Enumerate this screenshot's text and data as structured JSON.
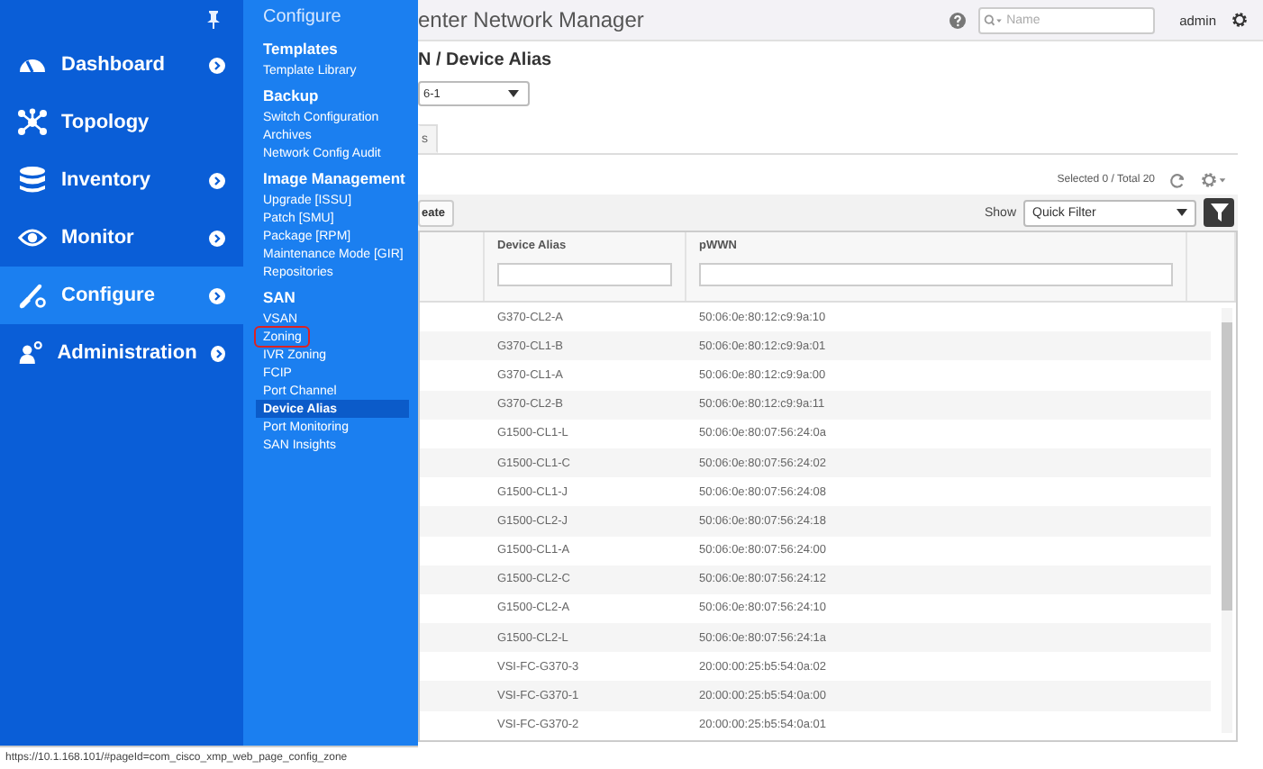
{
  "nav": {
    "items": [
      {
        "label": "Dashboard",
        "kind": "gauge",
        "has_arrow": true,
        "selected": false
      },
      {
        "label": "Topology",
        "kind": "nodes",
        "has_arrow": false,
        "selected": false
      },
      {
        "label": "Inventory",
        "kind": "database",
        "has_arrow": true,
        "selected": false
      },
      {
        "label": "Monitor",
        "kind": "eye",
        "has_arrow": true,
        "selected": false
      },
      {
        "label": "Configure",
        "kind": "wrench",
        "has_arrow": true,
        "selected": true
      },
      {
        "label": "Administration",
        "kind": "person",
        "has_arrow": true,
        "selected": false
      }
    ]
  },
  "flyout": {
    "title": "Configure",
    "sections": [
      {
        "heading": "Templates",
        "items": [
          {
            "label": "Template Library",
            "selected": false,
            "outlined": false
          }
        ]
      },
      {
        "heading": "Backup",
        "items": [
          {
            "label": "Switch Configuration",
            "selected": false,
            "outlined": false
          },
          {
            "label": "Archives",
            "selected": false,
            "outlined": false
          },
          {
            "label": "Network Config Audit",
            "selected": false,
            "outlined": false
          }
        ]
      },
      {
        "heading": "Image Management",
        "items": [
          {
            "label": "Upgrade [ISSU]",
            "selected": false,
            "outlined": false
          },
          {
            "label": "Patch [SMU]",
            "selected": false,
            "outlined": false
          },
          {
            "label": "Package [RPM]",
            "selected": false,
            "outlined": false
          },
          {
            "label": "Maintenance Mode [GIR]",
            "selected": false,
            "outlined": false
          },
          {
            "label": "Repositories",
            "selected": false,
            "outlined": false
          }
        ]
      },
      {
        "heading": "SAN",
        "items": [
          {
            "label": "VSAN",
            "selected": false,
            "outlined": false
          },
          {
            "label": "Zoning",
            "selected": false,
            "outlined": true
          },
          {
            "label": "IVR Zoning",
            "selected": false,
            "outlined": false
          },
          {
            "label": "FCIP",
            "selected": false,
            "outlined": false
          },
          {
            "label": "Port Channel",
            "selected": false,
            "outlined": false
          },
          {
            "label": "Device Alias",
            "selected": true,
            "outlined": false
          },
          {
            "label": "Port Monitoring",
            "selected": false,
            "outlined": false
          },
          {
            "label": "SAN Insights",
            "selected": false,
            "outlined": false
          }
        ]
      }
    ]
  },
  "header": {
    "title": "enter Network Manager",
    "search": {
      "placeholder": "Name"
    },
    "user": "admin"
  },
  "breadcrumb": "N / Device Alias",
  "switch_select": {
    "value": "6-1"
  },
  "tabs": [
    {
      "label": "s",
      "selected": true
    }
  ],
  "selection_summary": "Selected 0 / Total 20",
  "toolbar": {
    "create_button": "eate",
    "show_label": "Show",
    "filter_select": {
      "value": "Quick Filter"
    }
  },
  "table": {
    "columns": [
      {
        "label": "Device Alias"
      },
      {
        "label": "pWWN"
      }
    ],
    "rows": [
      {
        "device_alias": "G370-CL2-A",
        "pwwn": "50:06:0e:80:12:c9:9a:10"
      },
      {
        "device_alias": "G370-CL1-B",
        "pwwn": "50:06:0e:80:12:c9:9a:01"
      },
      {
        "device_alias": "G370-CL1-A",
        "pwwn": "50:06:0e:80:12:c9:9a:00"
      },
      {
        "device_alias": "G370-CL2-B",
        "pwwn": "50:06:0e:80:12:c9:9a:11"
      },
      {
        "device_alias": "G1500-CL1-L",
        "pwwn": "50:06:0e:80:07:56:24:0a"
      },
      {
        "device_alias": "G1500-CL1-C",
        "pwwn": "50:06:0e:80:07:56:24:02"
      },
      {
        "device_alias": "G1500-CL1-J",
        "pwwn": "50:06:0e:80:07:56:24:08"
      },
      {
        "device_alias": "G1500-CL2-J",
        "pwwn": "50:06:0e:80:07:56:24:18"
      },
      {
        "device_alias": "G1500-CL1-A",
        "pwwn": "50:06:0e:80:07:56:24:00"
      },
      {
        "device_alias": "G1500-CL2-C",
        "pwwn": "50:06:0e:80:07:56:24:12"
      },
      {
        "device_alias": "G1500-CL2-A",
        "pwwn": "50:06:0e:80:07:56:24:10"
      },
      {
        "device_alias": "G1500-CL2-L",
        "pwwn": "50:06:0e:80:07:56:24:1a"
      },
      {
        "device_alias": "VSI-FC-G370-3",
        "pwwn": "20:00:00:25:b5:54:0a:02"
      },
      {
        "device_alias": "VSI-FC-G370-1",
        "pwwn": "20:00:00:25:b5:54:0a:00"
      },
      {
        "device_alias": "VSI-FC-G370-2",
        "pwwn": "20:00:00:25:b5:54:0a:01"
      }
    ]
  },
  "status_bar": {
    "url": "https://10.1.168.101/#pageId=com_cisco_xmp_web_page_config_zone"
  }
}
